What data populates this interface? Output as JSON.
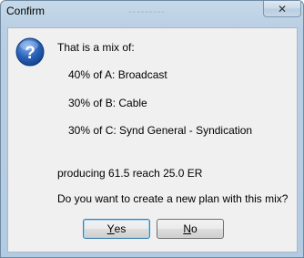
{
  "window": {
    "title": "Confirm",
    "title_ghost": "---------"
  },
  "message": {
    "intro": "That is a mix of:",
    "mix": [
      "40% of A: Broadcast",
      "30% of B: Cable",
      "30% of C: Synd General  - Syndication"
    ],
    "result": "producing 61.5 reach 25.0 ER",
    "question": "Do you want to create a new plan with this mix?"
  },
  "buttons": {
    "yes_mnemonic": "Y",
    "yes_rest": "es",
    "no_mnemonic": "N",
    "no_rest": "o",
    "close_glyph": "✕"
  },
  "colors": {
    "question_icon": "#2a62b8",
    "default_button_border": "#3c7fb1"
  },
  "icons": [
    "question-icon",
    "close-icon"
  ]
}
